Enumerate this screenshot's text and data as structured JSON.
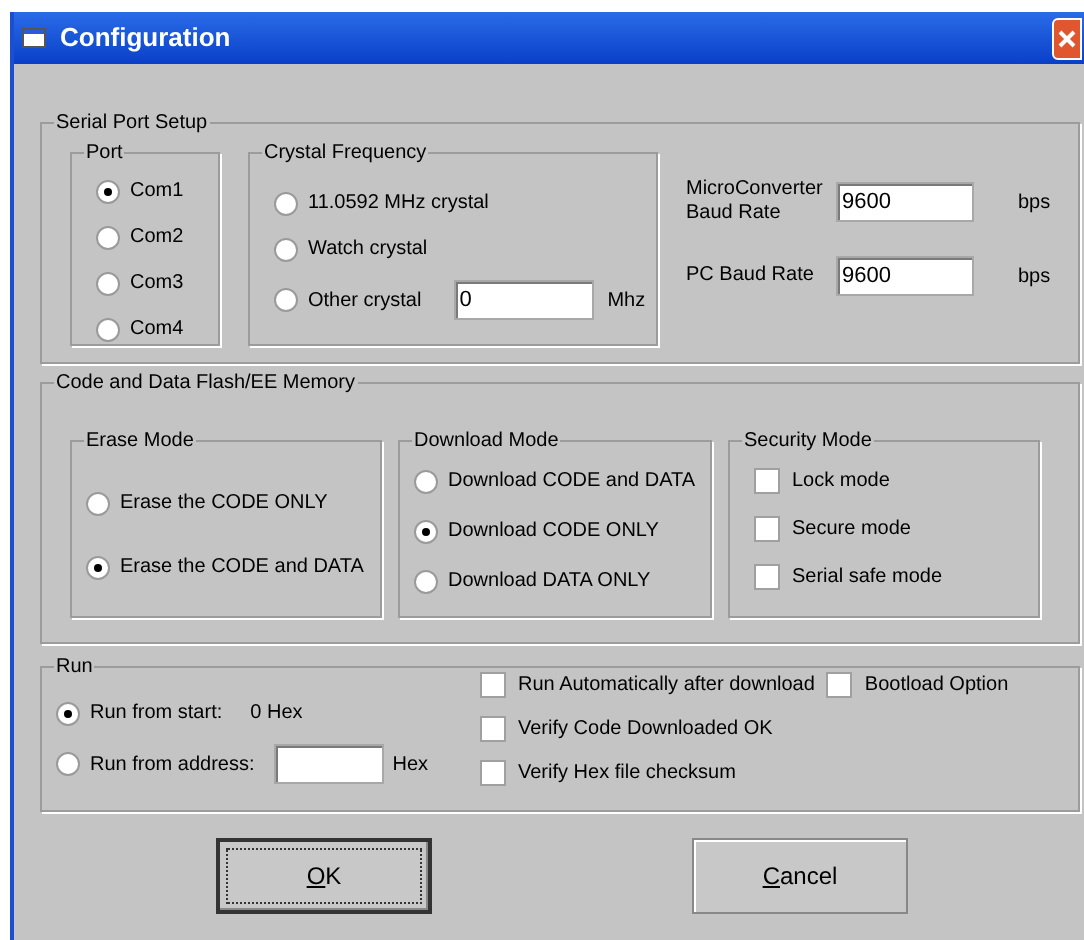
{
  "window": {
    "title": "Configuration"
  },
  "serial_port_setup": {
    "title": "Serial Port Setup",
    "port": {
      "title": "Port",
      "options": [
        {
          "label": "Com1",
          "selected": true
        },
        {
          "label": "Com2",
          "selected": false
        },
        {
          "label": "Com3",
          "selected": false
        },
        {
          "label": "Com4",
          "selected": false
        }
      ]
    },
    "crystal_frequency": {
      "title": "Crystal Frequency",
      "options": [
        {
          "label": "11.0592 MHz crystal",
          "selected": false
        },
        {
          "label": "Watch crystal",
          "selected": false
        },
        {
          "label": "Other crystal",
          "selected": false,
          "value": "0",
          "unit": "Mhz"
        }
      ]
    },
    "baud_rates": [
      {
        "label": "MicroConverter Baud Rate",
        "value": "9600",
        "unit": "bps"
      },
      {
        "label": "PC Baud Rate",
        "value": "9600",
        "unit": "bps"
      }
    ]
  },
  "memory": {
    "title": "Code and Data Flash/EE Memory",
    "erase_mode": {
      "title": "Erase Mode",
      "options": [
        {
          "label": "Erase the CODE ONLY",
          "selected": false
        },
        {
          "label": "Erase the CODE and DATA",
          "selected": true
        }
      ]
    },
    "download_mode": {
      "title": "Download Mode",
      "options": [
        {
          "label": "Download CODE and DATA",
          "selected": false
        },
        {
          "label": "Download CODE ONLY",
          "selected": true
        },
        {
          "label": "Download DATA ONLY",
          "selected": false
        }
      ]
    },
    "security_mode": {
      "title": "Security Mode",
      "options": [
        {
          "label": "Lock mode",
          "checked": false
        },
        {
          "label": "Secure mode",
          "checked": false
        },
        {
          "label": "Serial safe mode",
          "checked": false
        }
      ]
    }
  },
  "run": {
    "title": "Run",
    "start": {
      "label": "Run from start:",
      "selected": true,
      "value": "0 Hex"
    },
    "address": {
      "label": "Run from address:",
      "selected": false,
      "unit": "Hex"
    },
    "options": [
      {
        "label": "Run Automatically after download",
        "checked": false
      },
      {
        "label": "Verify Code Downloaded OK",
        "checked": false
      },
      {
        "label": "Verify Hex file checksum",
        "checked": false
      }
    ],
    "side_options": [
      {
        "label": "Bootload Option",
        "checked": false
      }
    ]
  },
  "buttons": [
    {
      "label": "OK",
      "underline_first": true,
      "default": true
    },
    {
      "label": "Cancel",
      "underline_first": true,
      "default": false
    }
  ]
}
